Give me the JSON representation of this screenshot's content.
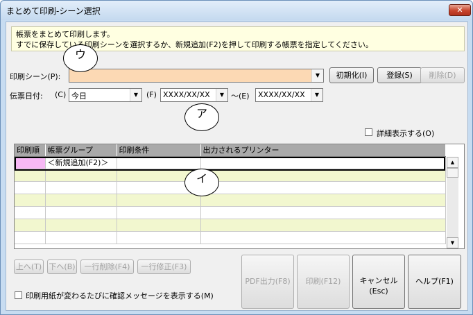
{
  "window": {
    "title": "まとめて印刷-シーン選択",
    "close_label": "✕"
  },
  "info": {
    "line1": "帳票をまとめて印刷します。",
    "line2": "すでに保存している印刷シーンを選択するか、新規追加(F2)を押して印刷する帳票を指定してください。"
  },
  "scene": {
    "label": "印刷シーン(P):",
    "value": "",
    "init_button": "初期化(I)",
    "register_button": "登録(S)",
    "delete_button": "削除(D)"
  },
  "date": {
    "label": "伝票日付:",
    "c_label": "(C)",
    "c_value": "今日",
    "f_label": "(F)",
    "f_value": "XXXX/XX/XX",
    "range_sep": "～(E)",
    "e_value": "XXXX/XX/XX"
  },
  "detail_checkbox": {
    "label": "詳細表示する(O)",
    "checked": false
  },
  "table": {
    "columns": [
      "印刷順",
      "帳票グループ",
      "印刷条件",
      "出力されるプリンター"
    ],
    "new_row_label": "＜新規追加(F2)＞",
    "empty_rows": 6
  },
  "row_buttons": {
    "up": "上へ(T)",
    "down": "下へ(B)",
    "delete_row": "一行削除(F4)",
    "edit_row": "一行修正(F3)"
  },
  "bottom_buttons": {
    "pdf": "PDF出力(F8)",
    "print": "印刷(F12)",
    "cancel_line1": "キャンセル",
    "cancel_line2": "(Esc)",
    "help": "ヘルプ(F1)"
  },
  "confirm_checkbox": {
    "label": "印刷用紙が変わるたびに確認メッセージを表示する(M)",
    "checked": false
  },
  "annotations": {
    "u": "ウ",
    "a": "ア",
    "i": "イ"
  },
  "icons": {
    "dropdown": "triangle-down-icon",
    "scroll_up": "triangle-up-icon",
    "scroll_down": "triangle-down-icon"
  }
}
